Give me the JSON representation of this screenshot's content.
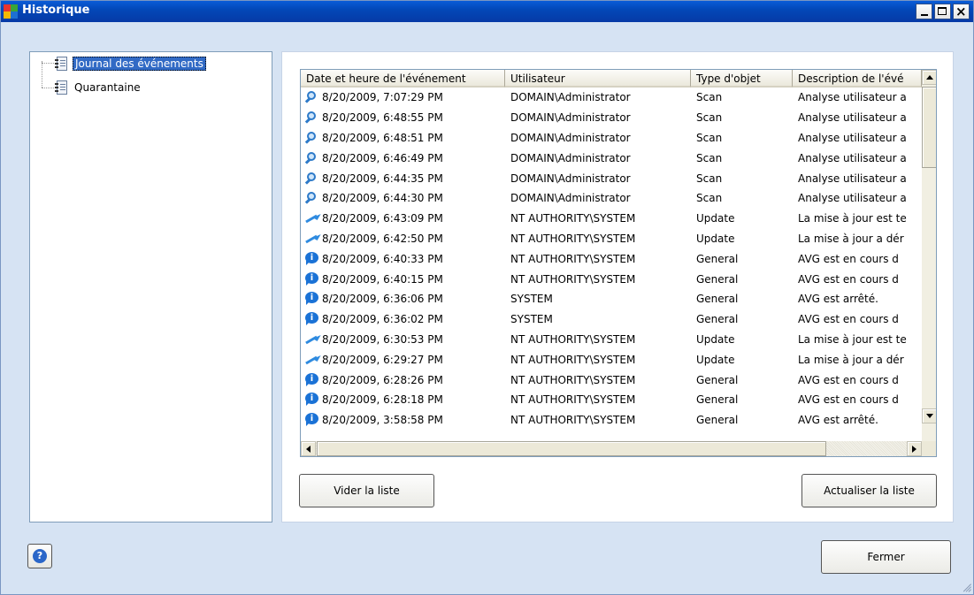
{
  "window": {
    "title": "Historique",
    "minimize_label": "_",
    "close_label": "×"
  },
  "tree": {
    "items": [
      {
        "label": "Journal des événements",
        "selected": true
      },
      {
        "label": "Quarantaine",
        "selected": false
      }
    ]
  },
  "table": {
    "columns": [
      "Date et heure de l'événement",
      "Utilisateur",
      "Type d'objet",
      "Description de l'évé"
    ],
    "rows": [
      {
        "icon": "magnifier-icon",
        "date": "8/20/2009, 7:07:29 PM",
        "user": "DOMAIN\\Administrator",
        "type": "Scan",
        "desc": "Analyse utilisateur a"
      },
      {
        "icon": "magnifier-icon",
        "date": "8/20/2009, 6:48:55 PM",
        "user": "DOMAIN\\Administrator",
        "type": "Scan",
        "desc": "Analyse utilisateur a"
      },
      {
        "icon": "magnifier-icon",
        "date": "8/20/2009, 6:48:51 PM",
        "user": "DOMAIN\\Administrator",
        "type": "Scan",
        "desc": "Analyse utilisateur a"
      },
      {
        "icon": "magnifier-icon",
        "date": "8/20/2009, 6:46:49 PM",
        "user": "DOMAIN\\Administrator",
        "type": "Scan",
        "desc": "Analyse utilisateur a"
      },
      {
        "icon": "magnifier-icon",
        "date": "8/20/2009, 6:44:35 PM",
        "user": "DOMAIN\\Administrator",
        "type": "Scan",
        "desc": "Analyse utilisateur a"
      },
      {
        "icon": "magnifier-icon",
        "date": "8/20/2009, 6:44:30 PM",
        "user": "DOMAIN\\Administrator",
        "type": "Scan",
        "desc": "Analyse utilisateur a"
      },
      {
        "icon": "update-arrow-icon",
        "date": "8/20/2009, 6:43:09 PM",
        "user": "NT AUTHORITY\\SYSTEM",
        "type": "Update",
        "desc": "La mise à jour est te"
      },
      {
        "icon": "update-arrow-icon",
        "date": "8/20/2009, 6:42:50 PM",
        "user": "NT AUTHORITY\\SYSTEM",
        "type": "Update",
        "desc": "La mise à jour a dér"
      },
      {
        "icon": "info-bubble-icon",
        "date": "8/20/2009, 6:40:33 PM",
        "user": "NT AUTHORITY\\SYSTEM",
        "type": "General",
        "desc": "AVG est en cours d"
      },
      {
        "icon": "info-bubble-icon",
        "date": "8/20/2009, 6:40:15 PM",
        "user": "NT AUTHORITY\\SYSTEM",
        "type": "General",
        "desc": "AVG est en cours d"
      },
      {
        "icon": "info-bubble-icon",
        "date": "8/20/2009, 6:36:06 PM",
        "user": "SYSTEM",
        "type": "General",
        "desc": "AVG est arrêté."
      },
      {
        "icon": "info-bubble-icon",
        "date": "8/20/2009, 6:36:02 PM",
        "user": "SYSTEM",
        "type": "General",
        "desc": "AVG est en cours d"
      },
      {
        "icon": "update-arrow-icon",
        "date": "8/20/2009, 6:30:53 PM",
        "user": "NT AUTHORITY\\SYSTEM",
        "type": "Update",
        "desc": "La mise à jour est te"
      },
      {
        "icon": "update-arrow-icon",
        "date": "8/20/2009, 6:29:27 PM",
        "user": "NT AUTHORITY\\SYSTEM",
        "type": "Update",
        "desc": "La mise à jour a dér"
      },
      {
        "icon": "info-bubble-icon",
        "date": "8/20/2009, 6:28:26 PM",
        "user": "NT AUTHORITY\\SYSTEM",
        "type": "General",
        "desc": "AVG est en cours d"
      },
      {
        "icon": "info-bubble-icon",
        "date": "8/20/2009, 6:28:18 PM",
        "user": "NT AUTHORITY\\SYSTEM",
        "type": "General",
        "desc": "AVG est en cours d"
      },
      {
        "icon": "info-bubble-icon",
        "date": "8/20/2009, 3:58:58 PM",
        "user": "NT AUTHORITY\\SYSTEM",
        "type": "General",
        "desc": "AVG est arrêté."
      }
    ]
  },
  "buttons": {
    "clear": "Vider la liste",
    "refresh": "Actualiser la liste",
    "close": "Fermer",
    "help": "?"
  },
  "colors": {
    "titlebar": "#0a5cd8",
    "selection": "#316ac5",
    "dialog_background": "#d6e3f3",
    "icon_blue": "#1a72d6"
  }
}
